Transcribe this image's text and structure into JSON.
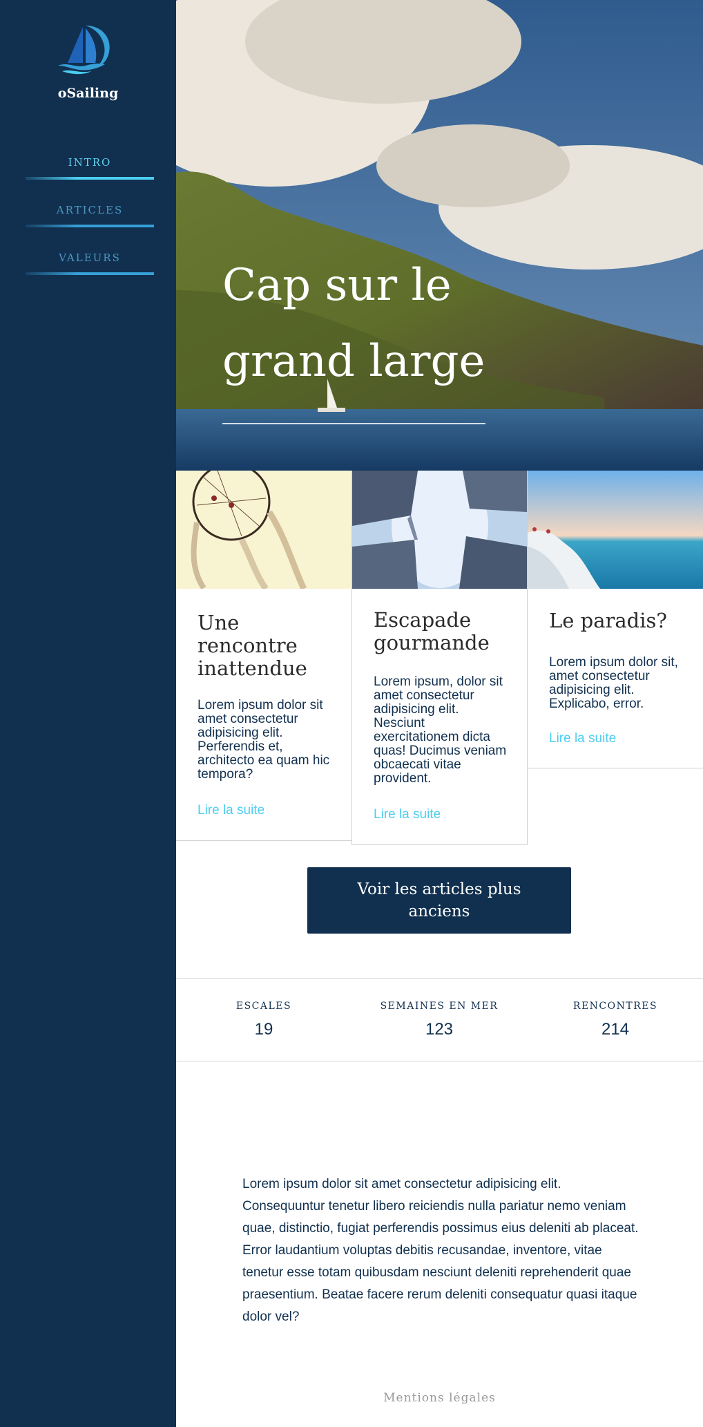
{
  "brand": {
    "name": "oSailing",
    "logo_icon": "sailboat-logo-icon"
  },
  "nav": {
    "items": [
      {
        "label": "INTRO",
        "active": true
      },
      {
        "label": "ARTICLES",
        "active": false
      },
      {
        "label": "VALEURS",
        "active": false
      }
    ]
  },
  "hero": {
    "title_line1": "Cap sur le",
    "title_line2": "grand large"
  },
  "articles": [
    {
      "image": "dreamcatcher-image",
      "title": "Une rencontre inattendue",
      "text": "Lorem ipsum dolor sit amet consectetur adipisicing elit. Perferendis et, architecto ea quam hic tempora?",
      "link": "Lire la suite"
    },
    {
      "image": "concrete-blocks-sky-image",
      "title": "Escapade gourmande",
      "text": "Lorem ipsum, dolor sit amet consectetur adipisicing elit. Nesciunt exercitationem dicta quas! Ducimus veniam obcaecati vitae provident.",
      "link": "Lire la suite"
    },
    {
      "image": "seaside-rocks-image",
      "title": "Le paradis?",
      "text": "Lorem ipsum dolor sit, amet consectetur adipisicing elit. Explicabo, error.",
      "link": "Lire la suite"
    }
  ],
  "older_button": "Voir les articles plus anciens",
  "stats": [
    {
      "label": "ESCALES",
      "value": "19"
    },
    {
      "label": "SEMAINES EN MER",
      "value": "123"
    },
    {
      "label": "RENCONTRES",
      "value": "214"
    }
  ],
  "body_text": "Lorem ipsum dolor sit amet consectetur adipisicing elit. Consequuntur tenetur libero reiciendis nulla pariatur nemo veniam quae, distinctio, fugiat perferendis possimus eius deleniti ab placeat. Error laudantium voluptas debitis recusandae, inventore, vitae tenetur esse totam quibusdam nesciunt deleniti reprehenderit quae praesentium. Beatae facere rerum deleniti consequatur quasi itaque dolor vel?",
  "footer": {
    "link": "Mentions légales"
  },
  "colors": {
    "sidebar": "#11304f",
    "accent": "#4ccdf0",
    "nav_text": "#4d97c2",
    "button": "#11304f"
  }
}
